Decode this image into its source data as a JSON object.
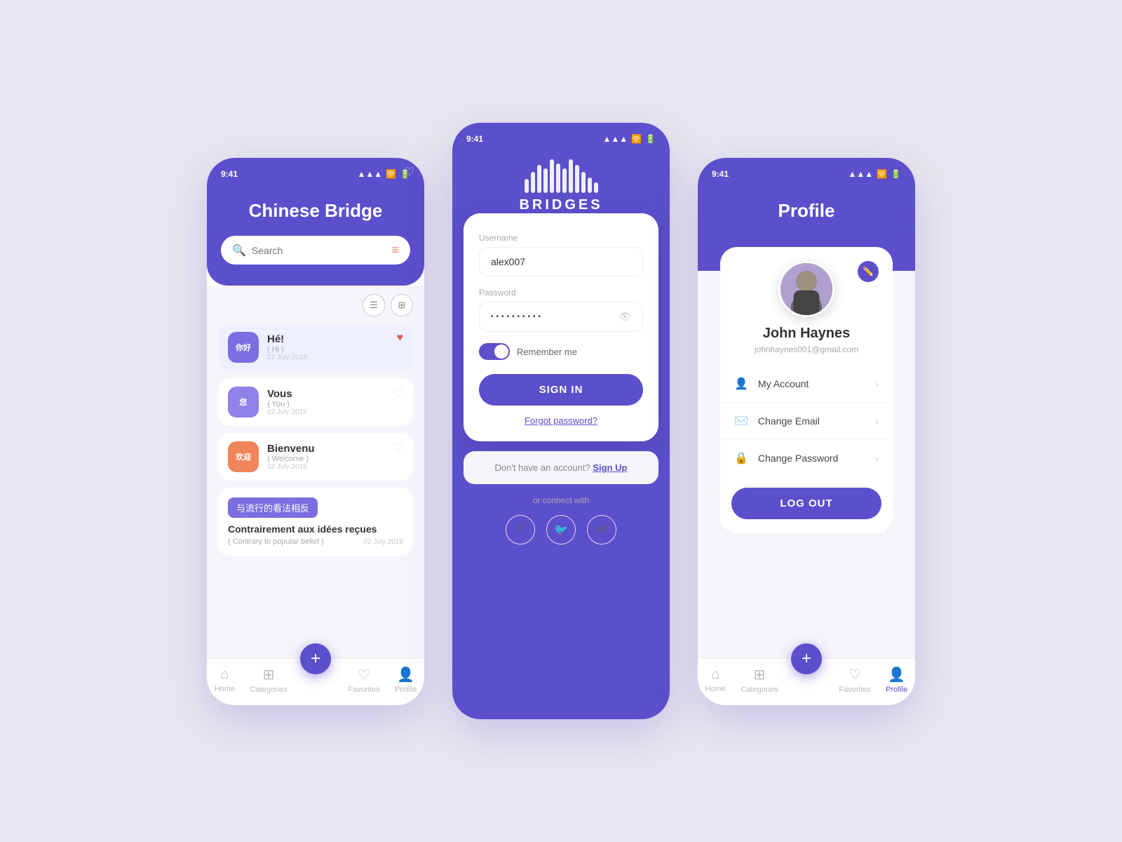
{
  "background": "#e8e8f0",
  "accent": "#5c4fcc",
  "phone1": {
    "status_time": "9:41",
    "title": "Chinese Bridge",
    "search_placeholder": "Search",
    "lessons": [
      {
        "badge": "你好",
        "badge_color": "badge-purple",
        "title": "Hé!",
        "sub": "( Hi )",
        "date": "02 July 2019",
        "liked": true
      },
      {
        "badge": "您",
        "badge_color": "badge-purple2",
        "title": "Vous",
        "sub": "( You )",
        "date": "02 July 2019",
        "liked": false
      },
      {
        "badge": "欢迎",
        "badge_color": "badge-orange",
        "title": "Bienvenu",
        "sub": "( Welcome )",
        "date": "02 July 2019",
        "liked": false
      }
    ],
    "lesson_tag": "与流行的看法相反",
    "lesson_title": "Contrairement aux idées reçues",
    "lesson_sub": "( Contrary to popular belief )",
    "lesson_date": "02 July 2019",
    "nav": {
      "home": "Home",
      "categories": "Categories",
      "favorites": "Favorites",
      "profile": "Profile"
    }
  },
  "phone2": {
    "status_time": "9:41",
    "app_name": "BRIDGES",
    "username_label": "Username",
    "username_value": "alex007",
    "password_label": "Password",
    "password_dots": "••••••••••",
    "remember_label": "Remember me",
    "sign_in_label": "SIGN IN",
    "forgot_label": "Forgot password?",
    "signup_text": "Don't have an account?",
    "signup_link": "Sign Up",
    "connect_label": "or connect with"
  },
  "phone3": {
    "status_time": "9:41",
    "title": "Profile",
    "user_name": "John Haynes",
    "user_email": "johnhaynes001@gmail.com",
    "menu": [
      {
        "icon": "👤",
        "label": "My Account"
      },
      {
        "icon": "✉️",
        "label": "Change Email"
      },
      {
        "icon": "🔒",
        "label": "Change Password"
      }
    ],
    "logout_label": "LOG OUT",
    "nav": {
      "home": "Home",
      "categories": "Categories",
      "favorites": "Favorites",
      "profile": "Profile"
    }
  }
}
